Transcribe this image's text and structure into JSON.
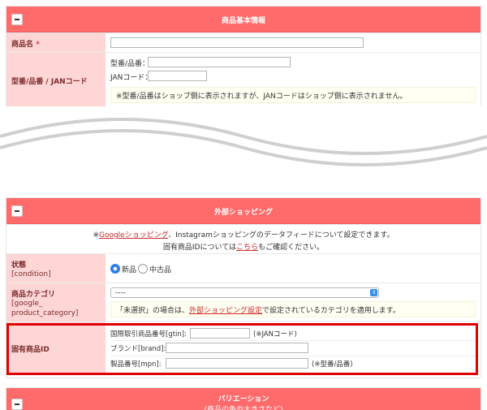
{
  "basic": {
    "header_title": "商品基本情報",
    "product_name_label": "商品名",
    "required_mark": "*",
    "code_label": "型番/品番 / JANコード",
    "model_label": "型番/品番：",
    "jan_label": "JANコード：",
    "note": "※型番/品番はショップ側に表示されますが、JANコードはショップ側に表示されません。"
  },
  "external": {
    "header_title": "外部ショッピング",
    "intro_prefix": "※",
    "intro_link": "Googleショッピング",
    "intro_suffix": "、Instagramショッピングのデータフィードについて設定できます。",
    "intro2_prefix": "固有商品IDについては",
    "intro2_link": "こちら",
    "intro2_suffix": "もご確認ください。",
    "condition_label": "状態",
    "condition_sub": "[condition]",
    "condition_new": "新品",
    "condition_used": "中古品",
    "condition_selected": "新品",
    "category_label": "商品カテゴリ",
    "category_sub1": "[google_",
    "category_sub2": "product_category]",
    "category_value": "----",
    "category_note_prefix": "「未選択」の場合は、",
    "category_note_link": "外部ショッピング設定",
    "category_note_suffix": "で設定されているカテゴリを適用します。",
    "id_label": "固有商品ID",
    "gtin_label": "国際取引商品番号[gtin]:",
    "gtin_hint": "(※JANコード)",
    "brand_label": "ブランド[brand]:",
    "mpn_label": "製品番号[mpn]:",
    "mpn_hint": "(※型番/品番)"
  },
  "variation": {
    "header_title": "バリエーション",
    "header_sub": "(商品の色や大きさなど)"
  }
}
